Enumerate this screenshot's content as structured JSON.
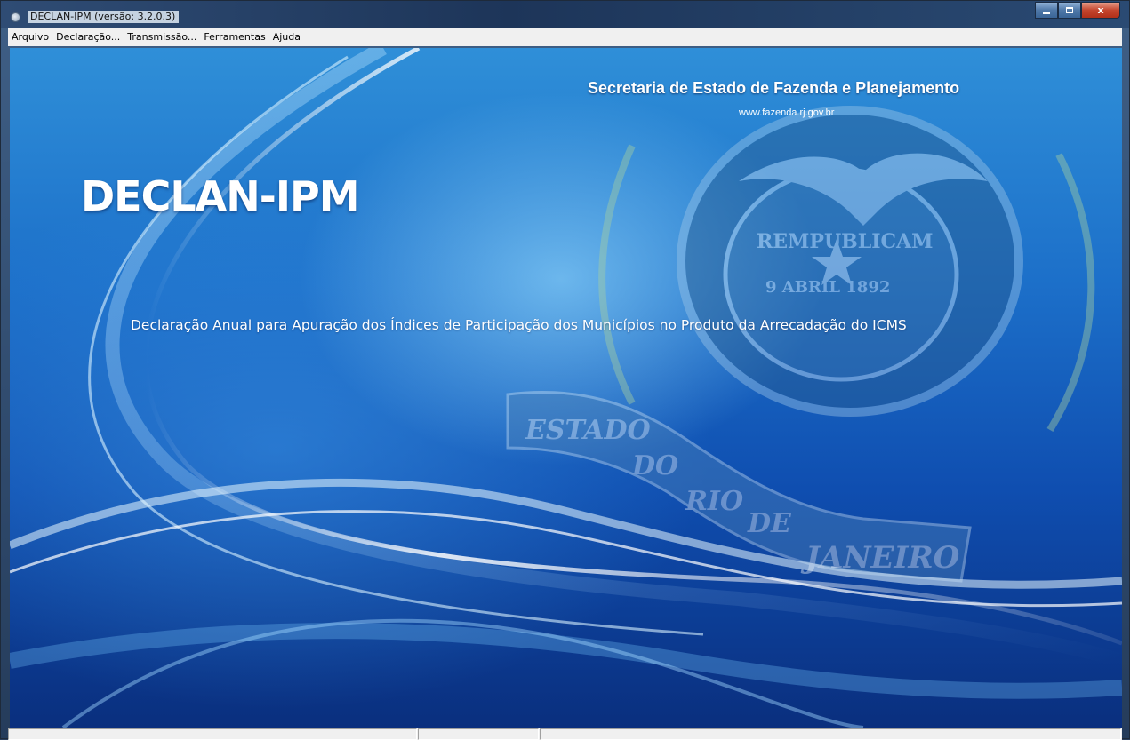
{
  "window": {
    "title": "DECLAN-IPM (versão: 3.2.0.3)",
    "close_glyph": "x"
  },
  "menu": {
    "items": [
      "Arquivo",
      "Declaração...",
      "Transmissão...",
      "Ferramentas",
      "Ajuda"
    ]
  },
  "splash": {
    "org_name": "Secretaria de Estado de Fazenda e Planejamento",
    "website": "www.fazenda.rj.gov.br",
    "app_name": "DECLAN-IPM",
    "description": "Declaração Anual para Apuração dos Índices de Participação dos Municípios no Produto da Arrecadação do ICMS"
  },
  "seal": {
    "upper_text": "REMPUBLICAM",
    "date": "9 ABRIL 1892",
    "ribbon": [
      "ESTADO",
      "DO",
      "RIO",
      "DE",
      "JANEIRO"
    ]
  },
  "colors": {
    "background_top": "#2f8fd8",
    "background_bottom": "#0a2f7e",
    "text": "#ffffff"
  }
}
